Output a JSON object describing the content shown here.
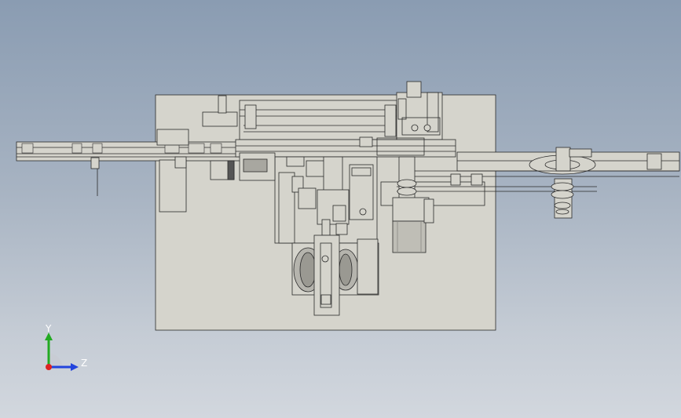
{
  "view": {
    "background_top": "#8a9cb2",
    "background_bottom": "#d2d7de",
    "part_fill": "#d5d4cc",
    "part_stroke": "#2a2a2a"
  },
  "triad": {
    "y_label": "Y",
    "z_label": "Z",
    "y_color": "#22aa22",
    "z_color": "#2244dd",
    "x_color": "#dd2222"
  }
}
